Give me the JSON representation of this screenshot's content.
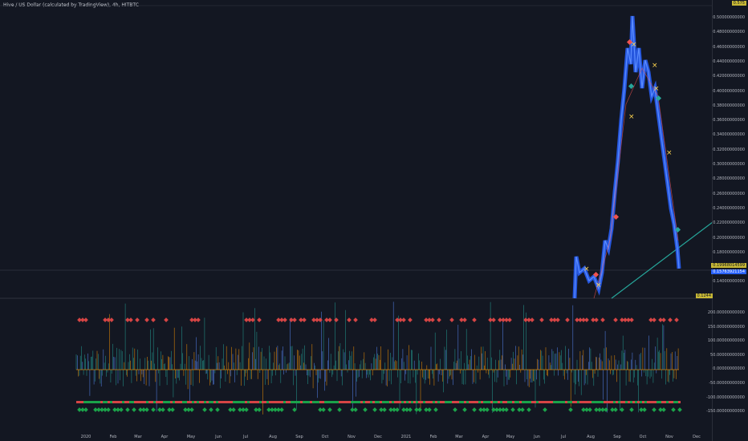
{
  "chart": {
    "title": "Hive / US Dollar (calculated by TradingView), 4h, HITBTC",
    "price_axis": [
      "0.50000000000",
      "0.48000000000",
      "0.46000000000",
      "0.44000000000",
      "0.42000000000",
      "0.40000000000",
      "0.38000000000",
      "0.36000000000",
      "0.34000000000",
      "0.32000000000",
      "0.30000000000",
      "0.28000000000",
      "0.26000000000",
      "0.24000000000",
      "0.22000000000",
      "0.20000000000",
      "0.18000000000",
      "0.16000000000",
      "0.14000000000"
    ],
    "price_tags": {
      "top": "0.575",
      "last": "0.19968014599",
      "current": "0.15763921154",
      "bottom": "0.1244"
    },
    "osc_axis": [
      "200.00000000000",
      "150.00000000000",
      "100.00000000000",
      "50.00000000000",
      "0.00000000000",
      "-50.00000000000",
      "-100.00000000000",
      "-150.00000000000"
    ],
    "time_axis": [
      "2020",
      "Feb",
      "Mar",
      "Apr",
      "May",
      "Jun",
      "Jul",
      "Aug",
      "Sep",
      "Oct",
      "Nov",
      "Dec",
      "2021",
      "Feb",
      "Mar",
      "Apr",
      "May",
      "Jun",
      "Jul",
      "Aug",
      "Sep",
      "Oct",
      "Nov",
      "Dec"
    ],
    "colors": {
      "bg": "#131722",
      "candles": "#2962ff",
      "trendline": "#26a69a",
      "buy": "#26a69a",
      "sell": "#ef5350",
      "osc_green": "#1ba34a",
      "osc_red": "#d64545",
      "orange": "#ff9800"
    }
  }
}
